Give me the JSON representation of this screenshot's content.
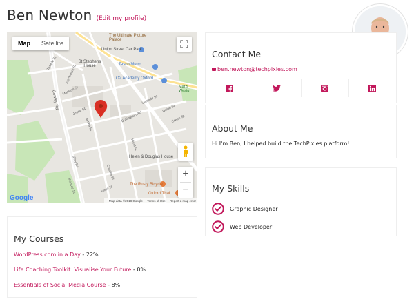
{
  "profile": {
    "name": "Ben Newton",
    "edit_link": "(Edit my profile)"
  },
  "map": {
    "type_buttons": [
      "Map",
      "Satellite"
    ],
    "active_type": "Map",
    "zoom_in": "+",
    "zoom_out": "−",
    "google_logo": "Google",
    "attribution": [
      "Map data ©2018 Google",
      "Terms of Use",
      "Report a map error"
    ],
    "places": [
      "The Ultimate Picture Palace",
      "Union Street Car Park",
      "St Stephens House",
      "Tesco Metro",
      "O2 Academy Oxford",
      "Marzi Westg",
      "Helen & Douglas House",
      "The Rusty Bicycle",
      "Oxford Thai"
    ],
    "streets": [
      "Temple St",
      "Stockmore St",
      "Marston St",
      "Cowley Rd",
      "Jeune St",
      "James St",
      "Bullingdon Rd",
      "Leopold St",
      "Union St",
      "Green St",
      "Manzil Way",
      "Percy St",
      "Charles St",
      "Hurst St",
      "Divinity Rd",
      "Bartlemas Cl",
      "Iffley Rd",
      "Princes St",
      "Aston St",
      "Stratford St",
      "Magdalen Rd",
      "Cricket Rd"
    ]
  },
  "contact": {
    "title": "Contact Me",
    "email": "ben.newton@techpixies.com",
    "social": [
      "facebook-icon",
      "twitter-icon",
      "instagram-icon",
      "linkedin-icon"
    ]
  },
  "about": {
    "title": "About Me",
    "text": "Hi I'm Ben, I helped build the TechPixies platform!"
  },
  "skills": {
    "title": "My Skills",
    "items": [
      {
        "label": "Graphic Designer",
        "icon": "check-circle-icon"
      },
      {
        "label": "Web Developer",
        "icon": "check-circle-icon"
      }
    ]
  },
  "courses": {
    "title": "My Courses",
    "items": [
      {
        "name": "WordPress.com in a Day",
        "progress": " - 22%"
      },
      {
        "name": "Life Coaching Toolkit: Visualise Your Future",
        "progress": " - 0%"
      },
      {
        "name": "Essentials of Social Media Course",
        "progress": " - 8%"
      }
    ]
  },
  "colors": {
    "accent": "#c2185b",
    "map_park": "#c8e6b7",
    "map_road": "#ffffff",
    "map_base": "#e8e6e1"
  }
}
